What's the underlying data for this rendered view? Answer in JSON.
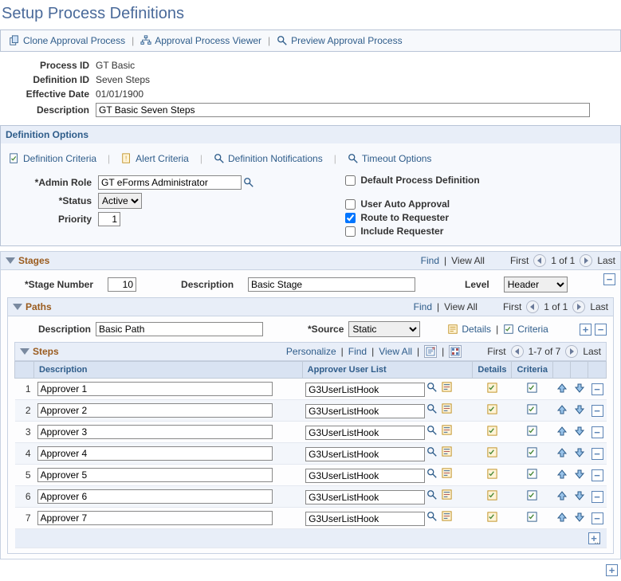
{
  "page_title": "Setup Process Definitions",
  "toolbar": {
    "clone": "Clone Approval Process",
    "viewer": "Approval Process Viewer",
    "preview": "Preview Approval Process"
  },
  "header_fields": {
    "process_id_label": "Process ID",
    "process_id": "GT Basic",
    "definition_id_label": "Definition ID",
    "definition_id": "Seven Steps",
    "effective_date_label": "Effective Date",
    "effective_date": "01/01/1900",
    "description_label": "Description",
    "description": "GT Basic Seven Steps"
  },
  "definition_options": {
    "title": "Definition Options",
    "criteria": "Definition Criteria",
    "alert": "Alert Criteria",
    "notifications": "Definition Notifications",
    "timeout": "Timeout Options",
    "admin_role_label": "*Admin Role",
    "admin_role": "GT eForms Administrator",
    "status_label": "*Status",
    "status": "Active",
    "priority_label": "Priority",
    "priority": "1",
    "default_process_label": "Default Process Definition",
    "default_process": false,
    "user_auto_label": "User Auto Approval",
    "user_auto": false,
    "route_req_label": "Route to Requester",
    "route_req": true,
    "include_req_label": "Include Requester",
    "include_req": false
  },
  "stages": {
    "title": "Stages",
    "find": "Find",
    "view_all": "View All",
    "first": "First",
    "count": "1 of 1",
    "last": "Last",
    "stage_number_label": "*Stage Number",
    "stage_number": "10",
    "description_label": "Description",
    "description": "Basic Stage",
    "level_label": "Level",
    "level": "Header"
  },
  "paths": {
    "title": "Paths",
    "find": "Find",
    "view_all": "View All",
    "first": "First",
    "count": "1 of 1",
    "last": "Last",
    "description_label": "Description",
    "description": "Basic Path",
    "source_label": "*Source",
    "source": "Static",
    "details": "Details",
    "criteria": "Criteria"
  },
  "steps": {
    "title": "Steps",
    "personalize": "Personalize",
    "find": "Find",
    "view_all": "View All",
    "first": "First",
    "count": "1-7 of 7",
    "last": "Last",
    "cols": {
      "num": "",
      "description": "Description",
      "approver_user_list": "Approver User List",
      "details": "Details",
      "criteria": "Criteria"
    },
    "rows": [
      {
        "n": "1",
        "desc": "Approver 1",
        "aul": "G3UserListHook"
      },
      {
        "n": "2",
        "desc": "Approver 2",
        "aul": "G3UserListHook"
      },
      {
        "n": "3",
        "desc": "Approver 3",
        "aul": "G3UserListHook"
      },
      {
        "n": "4",
        "desc": "Approver 4",
        "aul": "G3UserListHook"
      },
      {
        "n": "5",
        "desc": "Approver 5",
        "aul": "G3UserListHook"
      },
      {
        "n": "6",
        "desc": "Approver 6",
        "aul": "G3UserListHook"
      },
      {
        "n": "7",
        "desc": "Approver 7",
        "aul": "G3UserListHook"
      }
    ]
  }
}
